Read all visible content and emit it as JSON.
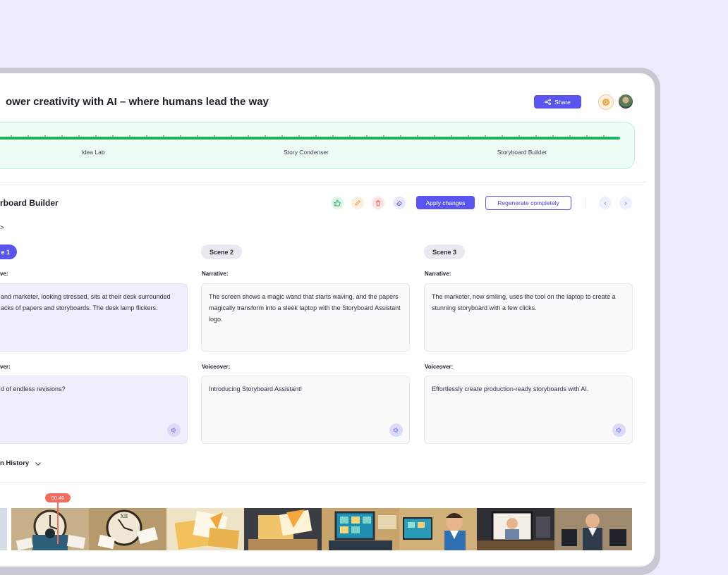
{
  "header": {
    "title": "ower creativity with AI – where humans lead the way",
    "share_label": "Share"
  },
  "stepper": {
    "steps": [
      {
        "label": "Idea Lab"
      },
      {
        "label": "Story Condenser"
      },
      {
        "label": "Storyboard Builder"
      }
    ],
    "accent": "#22b35e"
  },
  "section": {
    "title": "rboard Builder",
    "apply_label": "Apply changes",
    "regenerate_label": "Regenerate completely",
    "breadcrumb_arrow": ">",
    "icons": [
      "thumbs-up-icon",
      "pencil-icon",
      "trash-icon",
      "eraser-icon"
    ]
  },
  "scenes": [
    {
      "label": "e 1",
      "narrative_label": "ve:",
      "narrative": "and marketer, looking stressed, sits at their desk surrounded acks of papers and storyboards. The desk lamp flickers.",
      "voiceover_label": "ver:",
      "voiceover": "d of endless revisions?"
    },
    {
      "label": "Scene 2",
      "narrative_label": "Narrative:",
      "narrative": "The screen shows a magic wand that starts waving, and the papers magically transform into a sleek laptop with the Storyboard Assistant logo.",
      "voiceover_label": "Voiceover:",
      "voiceover": "Introducing Storyboard Assistant!"
    },
    {
      "label": "Scene 3",
      "narrative_label": "Narrative:",
      "narrative": "The marketer, now smiling, uses the tool on the laptop to create a stunning storyboard with a few clicks.",
      "voiceover_label": "Voiceover:",
      "voiceover": "Effortlessly create production-ready storyboards with AI."
    }
  ],
  "history": {
    "label": "n History"
  },
  "timeline": {
    "time": "00:40"
  },
  "colors": {
    "primary": "#5b55f0",
    "background": "#ecebfc",
    "playhead": "#f26b5b"
  }
}
